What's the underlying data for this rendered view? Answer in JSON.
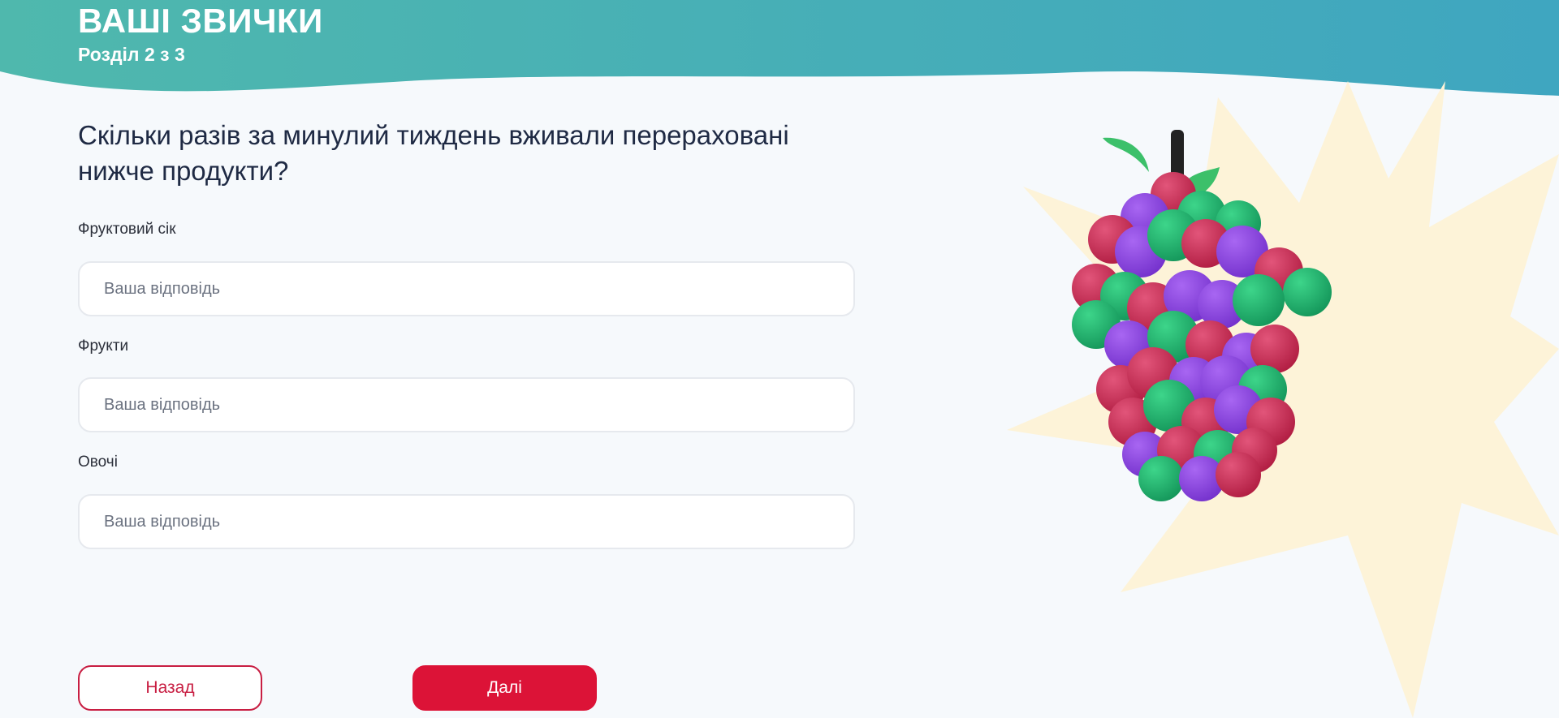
{
  "header": {
    "title": "ВАШІ ЗВИЧКИ",
    "subtitle": "Розділ 2 з 3",
    "gradient_start": "#4fb8ad",
    "gradient_end": "#3fa6c0"
  },
  "question": "Скільки разів за минулий тиждень вживали перераховані нижче продукти?",
  "fields": [
    {
      "label": "Фруктовий сік",
      "value": "",
      "placeholder": "Ваша відповідь"
    },
    {
      "label": "Фрукти",
      "value": "",
      "placeholder": "Ваша відповідь"
    },
    {
      "label": "Овочі",
      "value": "",
      "placeholder": "Ваша відповідь"
    }
  ],
  "buttons": {
    "back_label": "Назад",
    "next_label": "Далі"
  },
  "colors": {
    "accent": "#dc1337",
    "burst": "#fdf3d8",
    "grape_red": "#c8284e",
    "grape_green": "#1fae6a",
    "grape_purple": "#8a3de0"
  },
  "illustration": {
    "icon": "grapes-illustration"
  }
}
